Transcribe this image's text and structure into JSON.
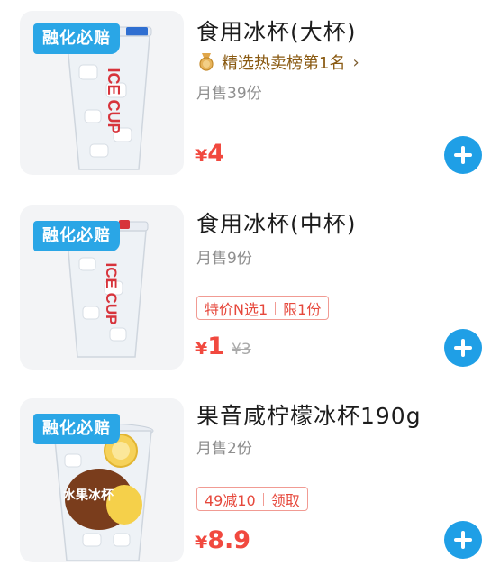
{
  "products": [
    {
      "badge": "融化必赔",
      "title": "食用冰杯(大杯)",
      "rank": "精选热卖榜第1名",
      "sales": "月售39份",
      "currency": "¥",
      "price": "4",
      "cup_label": "ICE CUP"
    },
    {
      "badge": "融化必赔",
      "title": "食用冰杯(中杯)",
      "sales": "月售9份",
      "promo_left": "特价N选1",
      "promo_right": "限1份",
      "currency": "¥",
      "price": "1",
      "original_price": "¥3",
      "cup_label": "ICE CUP"
    },
    {
      "badge": "融化必赔",
      "title": "果音咸柠檬冰杯190g",
      "sales": "月售2份",
      "promo_left": "49减10",
      "promo_right": "领取",
      "currency": "¥",
      "price": "8.9",
      "cup_label": "水果冰杯"
    }
  ],
  "colors": {
    "badge": "#2aa6e6",
    "price": "#f1493f",
    "add_button": "#1f9fe6",
    "rank_text": "#8a5a12"
  },
  "icons": [
    "medal-icon",
    "chevron-right-icon",
    "plus-icon"
  ]
}
